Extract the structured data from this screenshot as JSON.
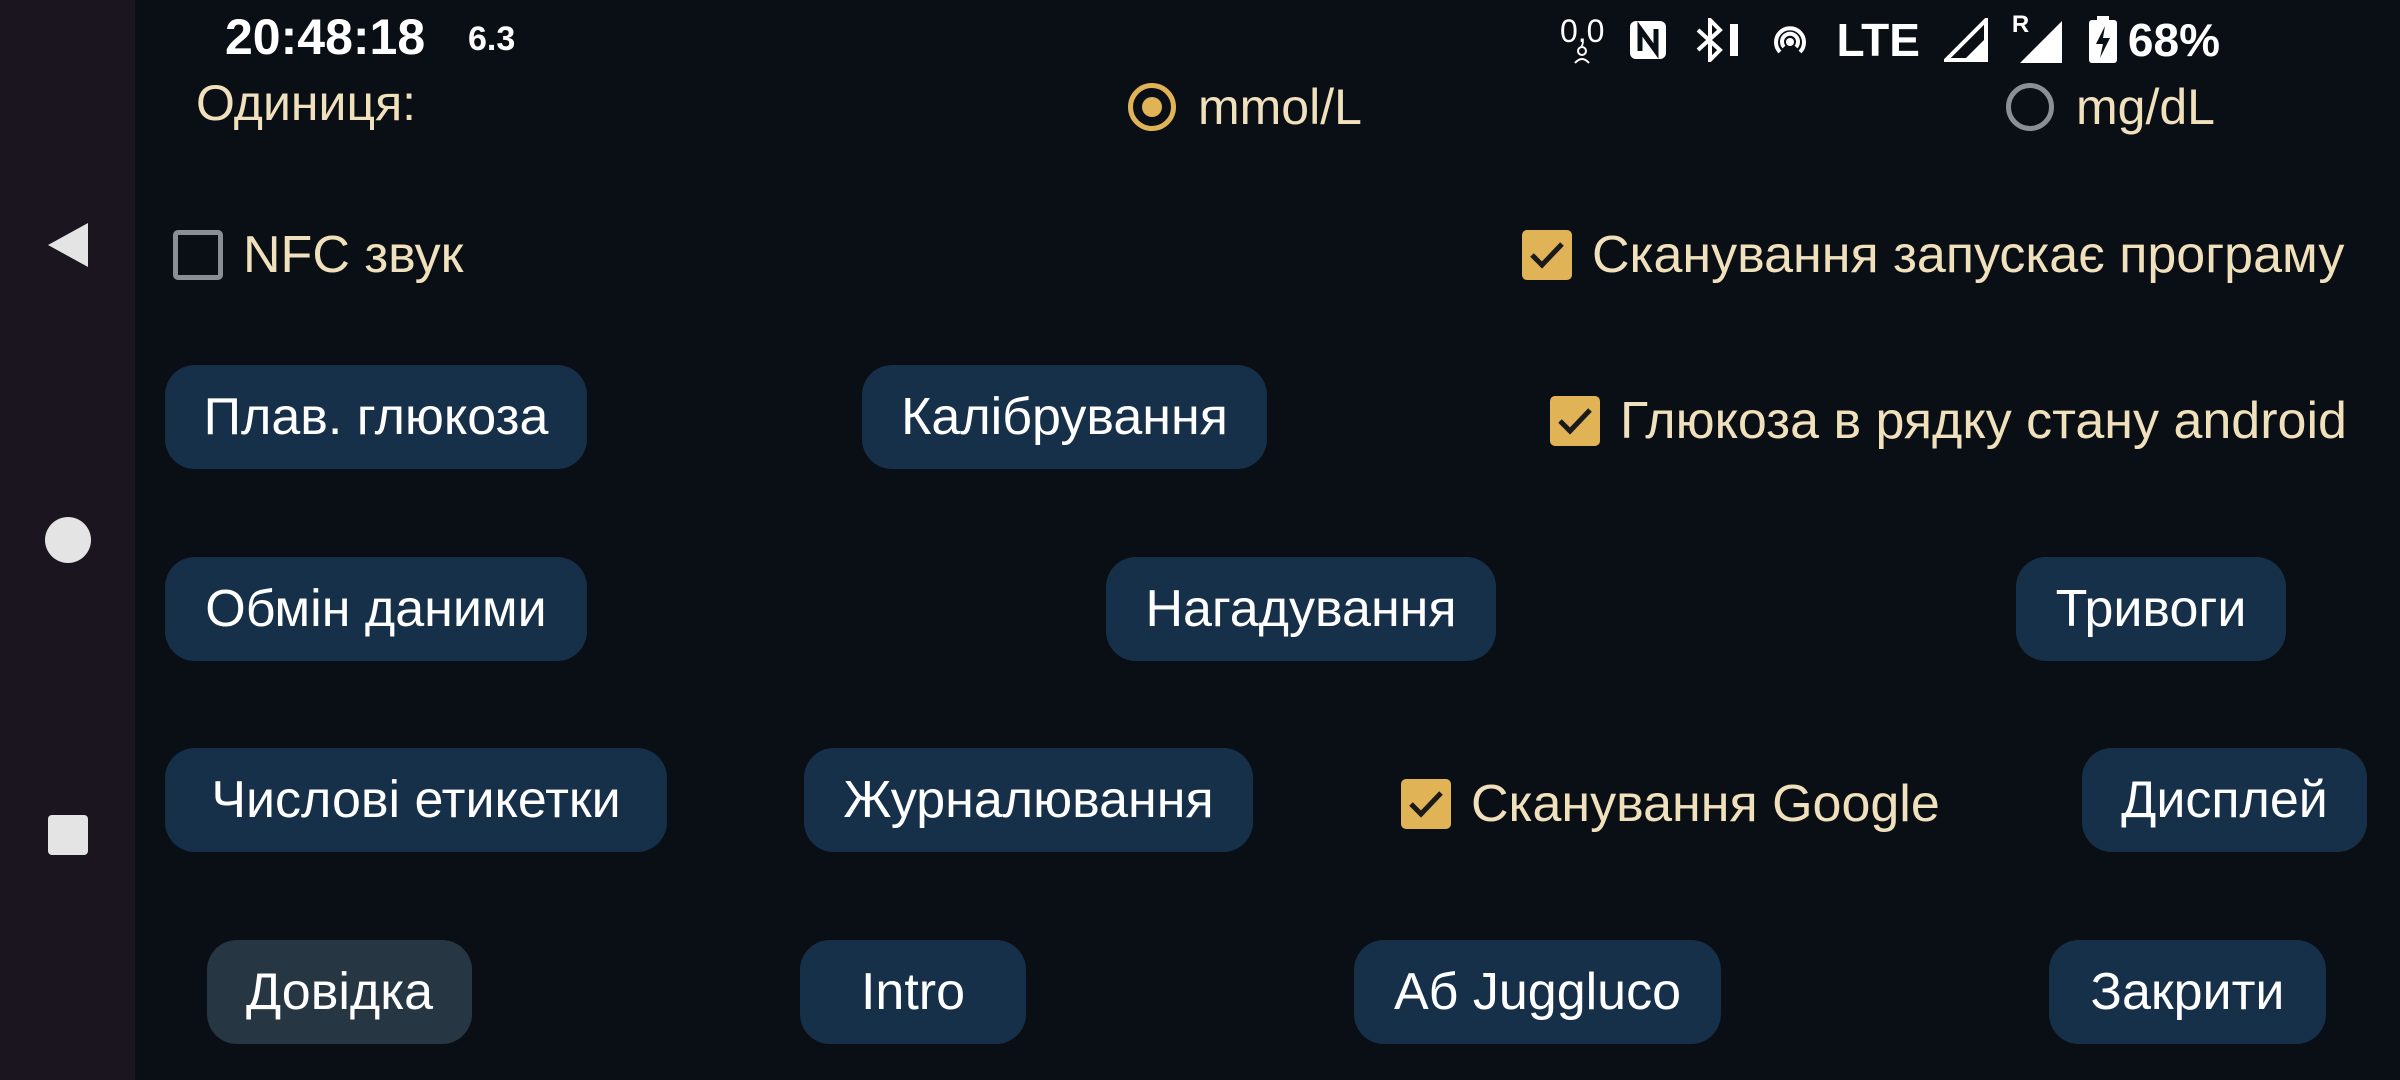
{
  "status_bar": {
    "time": "20:48:18",
    "glucose": "6.3",
    "data_rate_top": "0,0",
    "network": "LTE",
    "roaming": "R",
    "battery": "68%"
  },
  "nav": {
    "back_icon": "back-triangle-icon",
    "home_icon": "home-circle-icon",
    "recents_icon": "recents-square-icon"
  },
  "units": {
    "label": "Одиниця:",
    "options": [
      {
        "label": "mmol/L",
        "selected": true
      },
      {
        "label": "mg/dL",
        "selected": false
      }
    ]
  },
  "settings": {
    "nfc_sound": {
      "label": "NFC звук",
      "checked": false
    },
    "scan_starts_app": {
      "label": "Сканування запускає програму",
      "checked": true
    },
    "glucose_status_bar": {
      "label": "Глюкоза в рядку стану android",
      "checked": true
    },
    "google_scan": {
      "label": "Сканування Google",
      "checked": true
    }
  },
  "buttons": {
    "float_glucose": "Плав. глюкоза",
    "calibration": "Калібрування",
    "data_exchange": "Обмін даними",
    "reminders": "Нагадування",
    "alarms": "Тривоги",
    "numeric_labels": "Числові етикетки",
    "logging": "Журналювання",
    "display": "Дисплей",
    "help": "Довідка",
    "intro": "Intro",
    "about": "Аб Juggluco",
    "close": "Закрити"
  },
  "colors": {
    "background": "#0a0f16",
    "navbar": "#1b1520",
    "accent": "#e0b357",
    "label_text": "#f0e1bc",
    "button_bg": "#17304a",
    "button_muted_bg": "#263642"
  }
}
